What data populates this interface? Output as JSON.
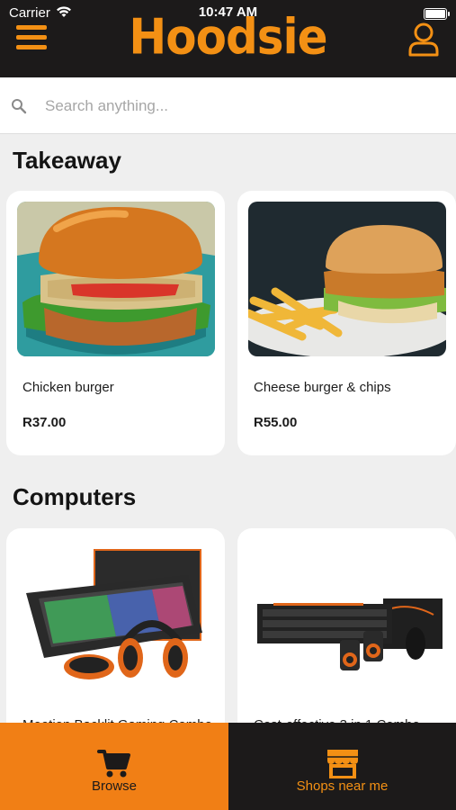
{
  "status_bar": {
    "carrier": "Carrier",
    "time": "10:47 AM"
  },
  "header": {
    "logo": "Hoodsie"
  },
  "search": {
    "placeholder": "Search anything..."
  },
  "sections": [
    {
      "title": "Takeaway",
      "items": [
        {
          "name": "Chicken burger",
          "price": "R37.00"
        },
        {
          "name": "Cheese burger & chips",
          "price": "R55.00"
        }
      ]
    },
    {
      "title": "Computers",
      "items": [
        {
          "name": "Meetion Backlit Gaming Combo",
          "price": ""
        },
        {
          "name": "Cost-effective 3 in 1 Combo",
          "price": ""
        }
      ]
    }
  ],
  "bottom_nav": {
    "browse": {
      "label": "Browse",
      "icon": "cart-icon"
    },
    "shops": {
      "label": "Shops near me",
      "icon": "shop-icon"
    }
  },
  "colors": {
    "brand_orange": "#f39014",
    "header_dark": "#1c1a1a",
    "browse_tab": "#f17f15",
    "background": "#efefef"
  }
}
